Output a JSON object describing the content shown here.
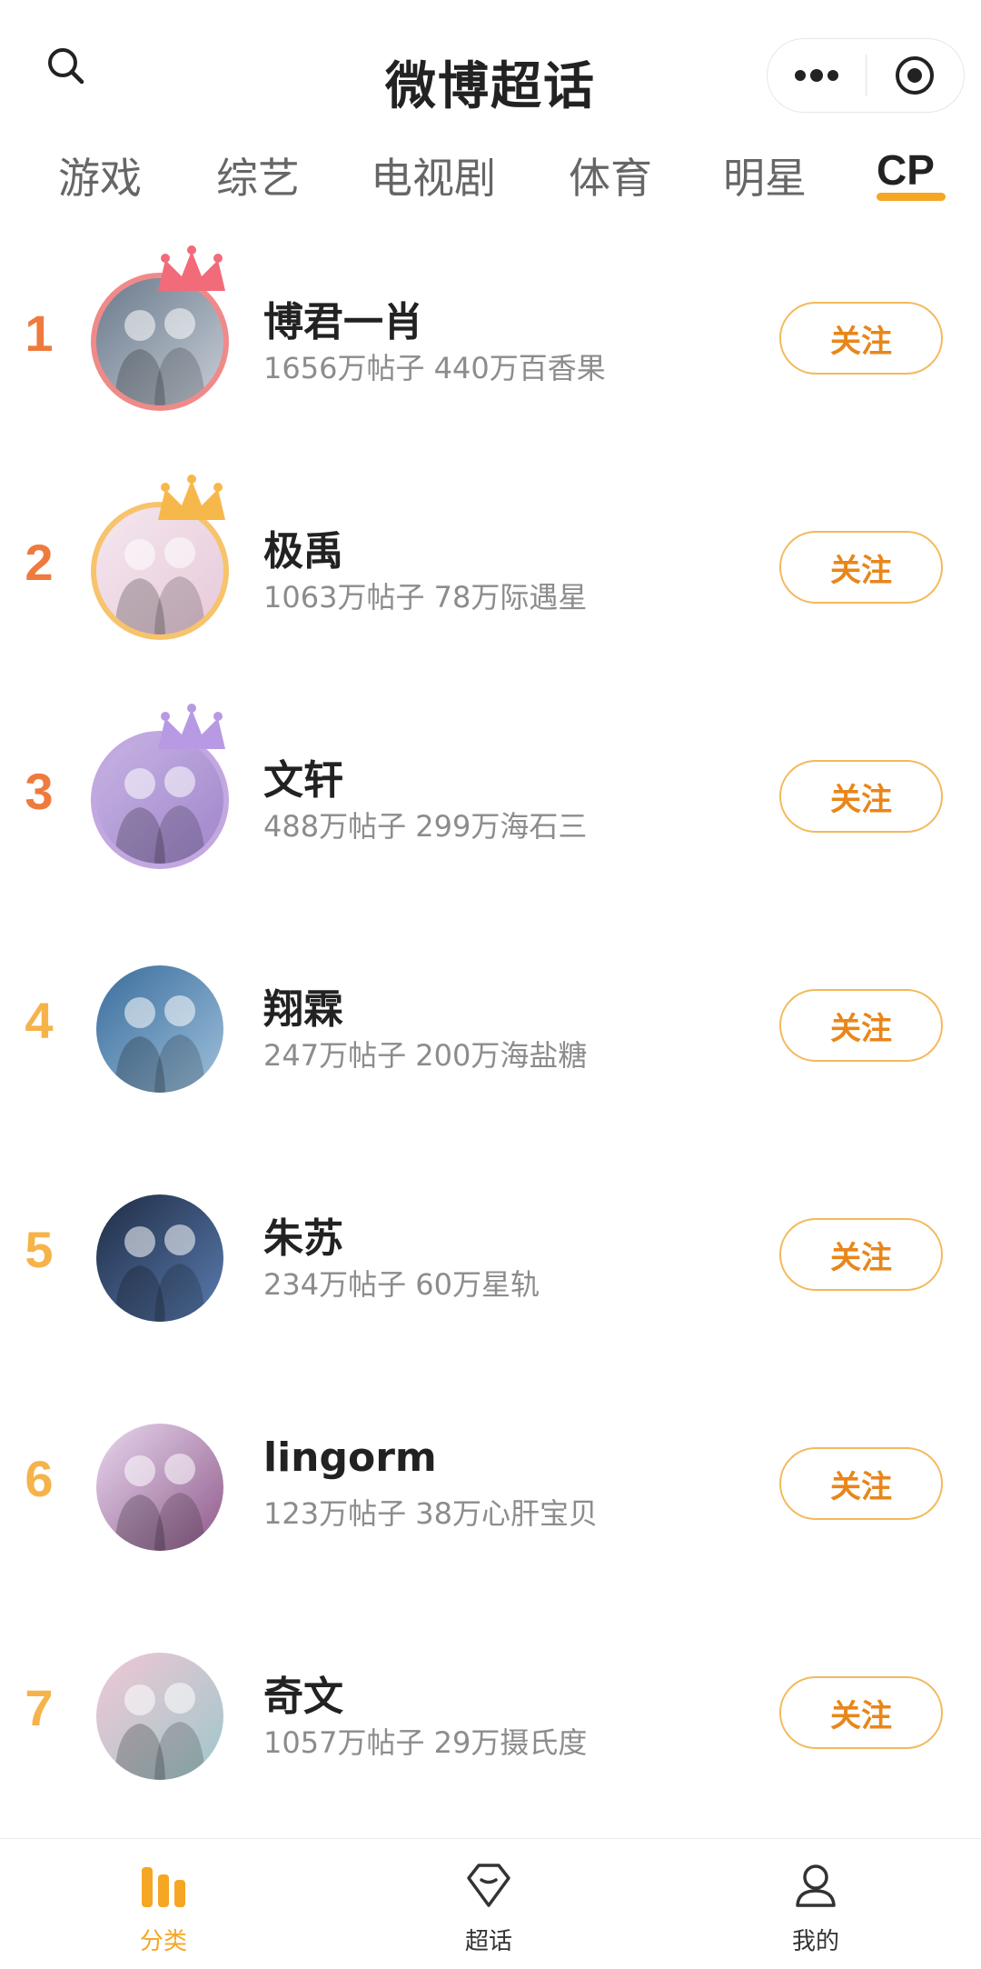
{
  "header": {
    "title": "微博超话",
    "search_icon": "search-icon",
    "more_icon": "more-dots-icon",
    "close_icon": "target-circle-icon"
  },
  "tabs": [
    {
      "label": "游戏",
      "active": false
    },
    {
      "label": "综艺",
      "active": false
    },
    {
      "label": "电视剧",
      "active": false
    },
    {
      "label": "体育",
      "active": false
    },
    {
      "label": "明星",
      "active": false
    },
    {
      "label": "CP",
      "active": true
    }
  ],
  "list": [
    {
      "rank": "1",
      "name": "博君一肖",
      "stats": "1656万帖子 440万百香果",
      "follow": "关注",
      "rank_color": "#ef7a3e",
      "ring_color": "#f08a8a",
      "crown_color": "#f26b7a",
      "avatar_colors": [
        "#6a7a8c",
        "#c7cdd6"
      ]
    },
    {
      "rank": "2",
      "name": "极禹",
      "stats": "1063万帖子 78万际遇星",
      "follow": "关注",
      "rank_color": "#ef7a3e",
      "ring_color": "#f7c36b",
      "crown_color": "#f7b84b",
      "avatar_colors": [
        "#f4e7ee",
        "#e7c9d9"
      ]
    },
    {
      "rank": "3",
      "name": "文轩",
      "stats": "488万帖子 299万海石三",
      "follow": "关注",
      "rank_color": "#ef7a3e",
      "ring_color": "#c2a7e0",
      "crown_color": "#b79ae3",
      "avatar_colors": [
        "#c7b3e3",
        "#9f86cb"
      ]
    },
    {
      "rank": "4",
      "name": "翔霖",
      "stats": "247万帖子 200万海盐糖",
      "follow": "关注",
      "rank_color": "#f5b34a",
      "avatar_colors": [
        "#3a6d9c",
        "#9ec0db"
      ]
    },
    {
      "rank": "5",
      "name": "朱苏",
      "stats": "234万帖子 60万星轨",
      "follow": "关注",
      "rank_color": "#f5b34a",
      "avatar_colors": [
        "#1f2c44",
        "#5a7cb0"
      ]
    },
    {
      "rank": "6",
      "name": "lingorm",
      "stats": "123万帖子 38万心肝宝贝",
      "follow": "关注",
      "rank_color": "#f5b34a",
      "avatar_colors": [
        "#e8d7ef",
        "#8e5a8a"
      ]
    },
    {
      "rank": "7",
      "name": "奇文",
      "stats": "1057万帖子 29万摄氏度",
      "follow": "关注",
      "rank_color": "#f5b34a",
      "avatar_colors": [
        "#f1c7d6",
        "#9ec7c9"
      ]
    }
  ],
  "bottombar": [
    {
      "label": "分类",
      "icon": "category-bars-icon",
      "active": true
    },
    {
      "label": "超话",
      "icon": "diamond-icon",
      "active": false
    },
    {
      "label": "我的",
      "icon": "user-icon",
      "active": false
    }
  ],
  "colors": {
    "accent": "#f5a623",
    "follow_text": "#e8861a",
    "follow_border": "#f3b95a"
  }
}
